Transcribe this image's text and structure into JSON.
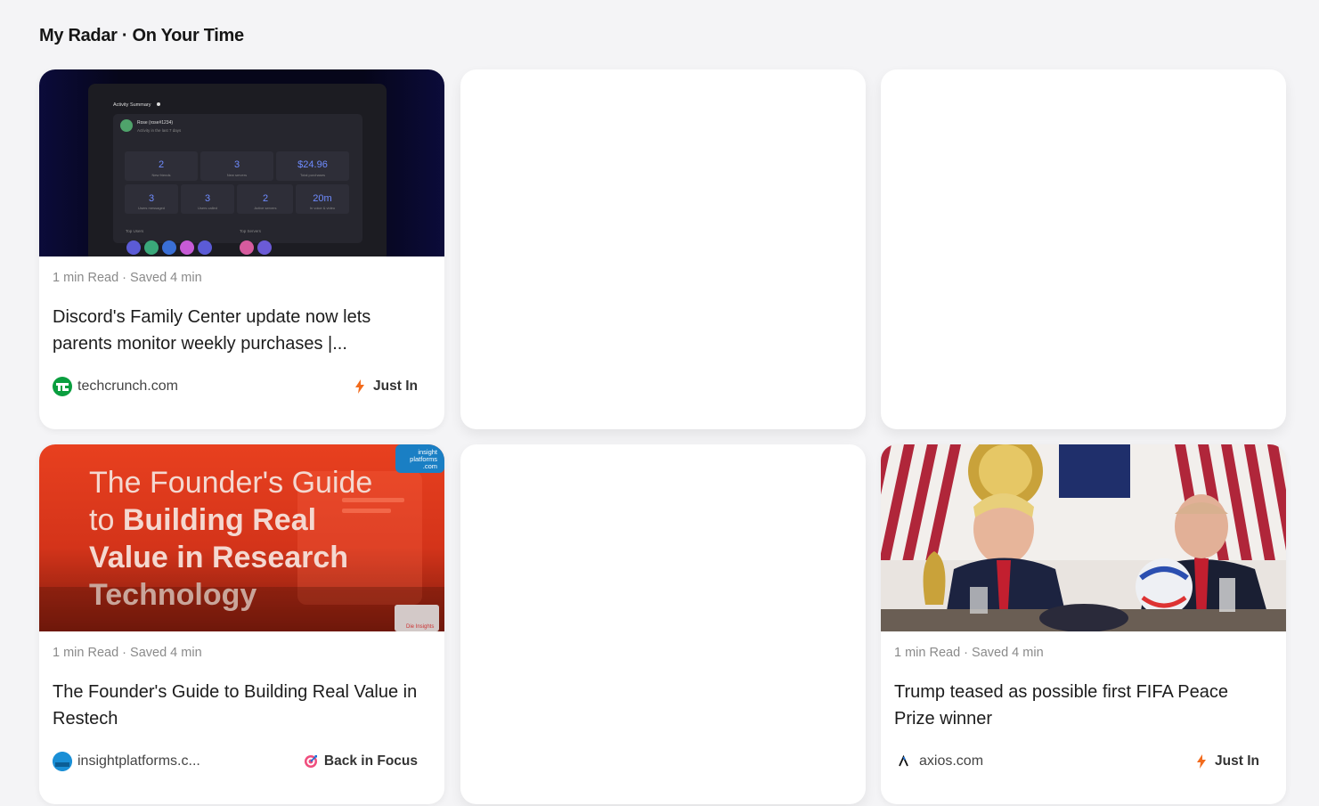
{
  "page": {
    "title": "My Radar · On Your Time"
  },
  "cards": [
    {
      "meta": "1 min Read · Saved 4 min",
      "title": "Discord's Family Center update now lets parents monitor weekly purchases |...",
      "source": "techcrunch.com",
      "tag": "Just In",
      "tag_icon": "lightning-icon",
      "thumb": {
        "heading": "Activity Summary",
        "user": "Rose (rose#1234)",
        "subtitle": "Activity in the last 7 days",
        "stats_row1": [
          {
            "value": "2",
            "label": "New friends"
          },
          {
            "value": "3",
            "label": "New servers"
          },
          {
            "value": "$24.96",
            "label": "Total purchases"
          }
        ],
        "stats_row2": [
          {
            "value": "3",
            "label": "Users messaged"
          },
          {
            "value": "3",
            "label": "Users called"
          },
          {
            "value": "2",
            "label": "Active servers"
          },
          {
            "value": "20m",
            "label": "In voice & video"
          }
        ],
        "top_users": "Top Users",
        "top_servers": "Top Servers"
      }
    },
    {
      "meta": "1 min Read · Saved 4 min",
      "title": "The Founder's Guide to Building Real Value in Restech",
      "source": "insightplatforms.c...",
      "tag": "Back in Focus",
      "tag_icon": "target-icon",
      "thumb": {
        "line1": "The Founder's Guide",
        "line2a": "to ",
        "line2b": "Building Real",
        "line3": "Value in Research",
        "line4": "Technology",
        "badge1": "insight",
        "badge2": "platforms",
        "badge3": ".com",
        "corner": "Die Insights"
      }
    },
    {
      "meta": "1 min Read · Saved 4 min",
      "title": "Trump teased as possible first FIFA Peace Prize winner",
      "source": "axios.com",
      "tag": "Just In",
      "tag_icon": "lightning-icon"
    }
  ],
  "colors": {
    "background": "#f4f4f6",
    "lightning": "#f26b1d",
    "techcrunch_green": "#0a9e3f",
    "founder_red": "#d9361b"
  }
}
